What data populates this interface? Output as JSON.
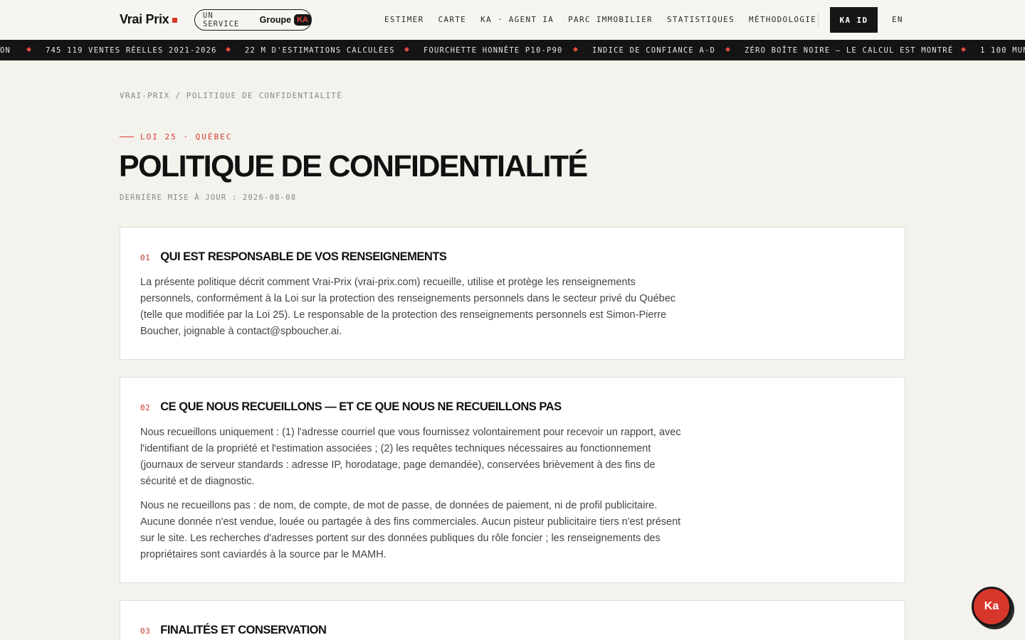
{
  "header": {
    "logo": "Vrai Prix",
    "service_prefix": "UN SERVICE",
    "service_group": "Groupe",
    "service_badge": "KA",
    "nav": [
      {
        "label": "ESTIMER",
        "name": "nav-estimer"
      },
      {
        "label": "CARTE",
        "name": "nav-carte"
      },
      {
        "label": "KA · AGENT IA",
        "name": "nav-agent-ia"
      },
      {
        "label": "PARC IMMOBILIER",
        "name": "nav-parc-immobilier"
      },
      {
        "label": "STATISTIQUES",
        "name": "nav-statistiques"
      },
      {
        "label": "MÉTHODOLOGIE",
        "name": "nav-methodologie"
      }
    ],
    "ka_id": "KA ID",
    "lang": "EN"
  },
  "ticker": {
    "items": [
      "ON",
      "745 119 VENTES RÉELLES 2021-2026",
      "22 M D'ESTIMATIONS CALCULÉES",
      "FOURCHETTE HONNÊTE P10-P90",
      "INDICE DE CONFIANCE A-D",
      "ZÉRO BOÎTE NOIRE — LE CALCUL EST MONTRÉ",
      "1 100 MUN"
    ],
    "accent": "#e04c3c"
  },
  "breadcrumb": "VRAI-PRIX / POLITIQUE DE CONFIDENTIALITÉ",
  "eyebrow": "LOI 25 · QUÉBEC",
  "title": "POLITIQUE DE CONFIDENTIALITÉ",
  "updated": "DERNIÈRE MISE À JOUR : 2026-08-08",
  "sections": [
    {
      "num": "01",
      "title": "QUI EST RESPONSABLE DE VOS RENSEIGNEMENTS",
      "paragraphs": [
        "La présente politique décrit comment Vrai-Prix (vrai-prix.com) recueille, utilise et protège les renseignements personnels, conformément à la Loi sur la protection des renseignements personnels dans le secteur privé du Québec (telle que modifiée par la Loi 25). Le responsable de la protection des renseignements personnels est Simon-Pierre Boucher, joignable à contact@spboucher.ai."
      ]
    },
    {
      "num": "02",
      "title": "CE QUE NOUS RECUEILLONS — ET CE QUE NOUS NE RECUEILLONS PAS",
      "paragraphs": [
        "Nous recueillons uniquement : (1) l'adresse courriel que vous fournissez volontairement pour recevoir un rapport, avec l'identifiant de la propriété et l'estimation associées ; (2) les requêtes techniques nécessaires au fonctionnement (journaux de serveur standards : adresse IP, horodatage, page demandée), conservées brièvement à des fins de sécurité et de diagnostic.",
        "Nous ne recueillons pas : de nom, de compte, de mot de passe, de données de paiement, ni de profil publicitaire. Aucune donnée n'est vendue, louée ou partagée à des fins commerciales. Aucun pisteur publicitaire tiers n'est présent sur le site. Les recherches d'adresses portent sur des données publiques du rôle foncier ; les renseignements des propriétaires sont caviardés à la source par le MAMH."
      ]
    },
    {
      "num": "03",
      "title": "FINALITÉS ET CONSERVATION",
      "paragraphs": []
    }
  ],
  "chat_button": "Ka",
  "colors": {
    "accent": "#d73a2c",
    "background": "#f3f2ed",
    "dark": "#141414"
  }
}
